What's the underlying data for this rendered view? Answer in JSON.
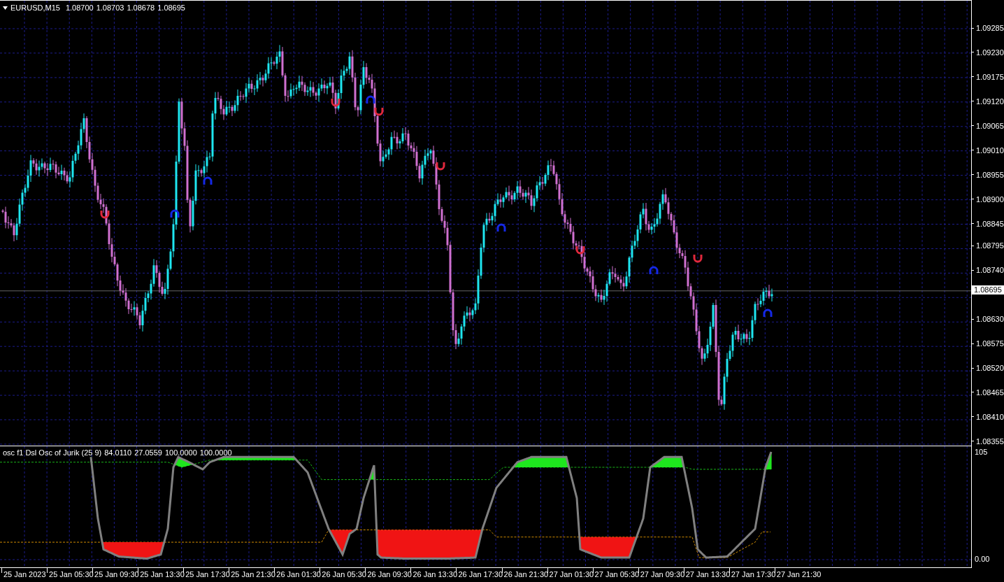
{
  "chart_header": {
    "symbol": "EURUSD,M15",
    "prices": [
      "1.08700",
      "1.08703",
      "1.08678",
      "1.08695"
    ]
  },
  "price_axis": {
    "labels": [
      "1.09285",
      "1.09230",
      "1.09175",
      "1.09120",
      "1.09065",
      "1.09010",
      "1.08955",
      "1.08900",
      "1.08845",
      "1.08795",
      "1.08740",
      "1.08630",
      "1.08575",
      "1.08520",
      "1.08465",
      "1.08410",
      "1.08355"
    ],
    "current_price": "1.08695"
  },
  "indicator": {
    "title": "osc f1 Dsl Osc of Jurik (25 9)",
    "values": [
      "84.0110",
      "27.0559",
      "100.0000",
      "100.0000"
    ],
    "axis_labels": [
      "105",
      "0.00"
    ]
  },
  "time_axis": {
    "labels": [
      "25 Jan 2023",
      "25 Jan 05:30",
      "25 Jan 09:30",
      "25 Jan 13:30",
      "25 Jan 17:30",
      "25 Jan 21:30",
      "26 Jan 01:30",
      "26 Jan 05:30",
      "26 Jan 09:30",
      "26 Jan 13:30",
      "26 Jan 17:30",
      "26 Jan 21:30",
      "27 Jan 01:30",
      "27 Jan 05:30",
      "27 Jan 09:30",
      "27 Jan 13:30",
      "27 Jan 17:30",
      "27 Jan 21:30"
    ]
  }
}
